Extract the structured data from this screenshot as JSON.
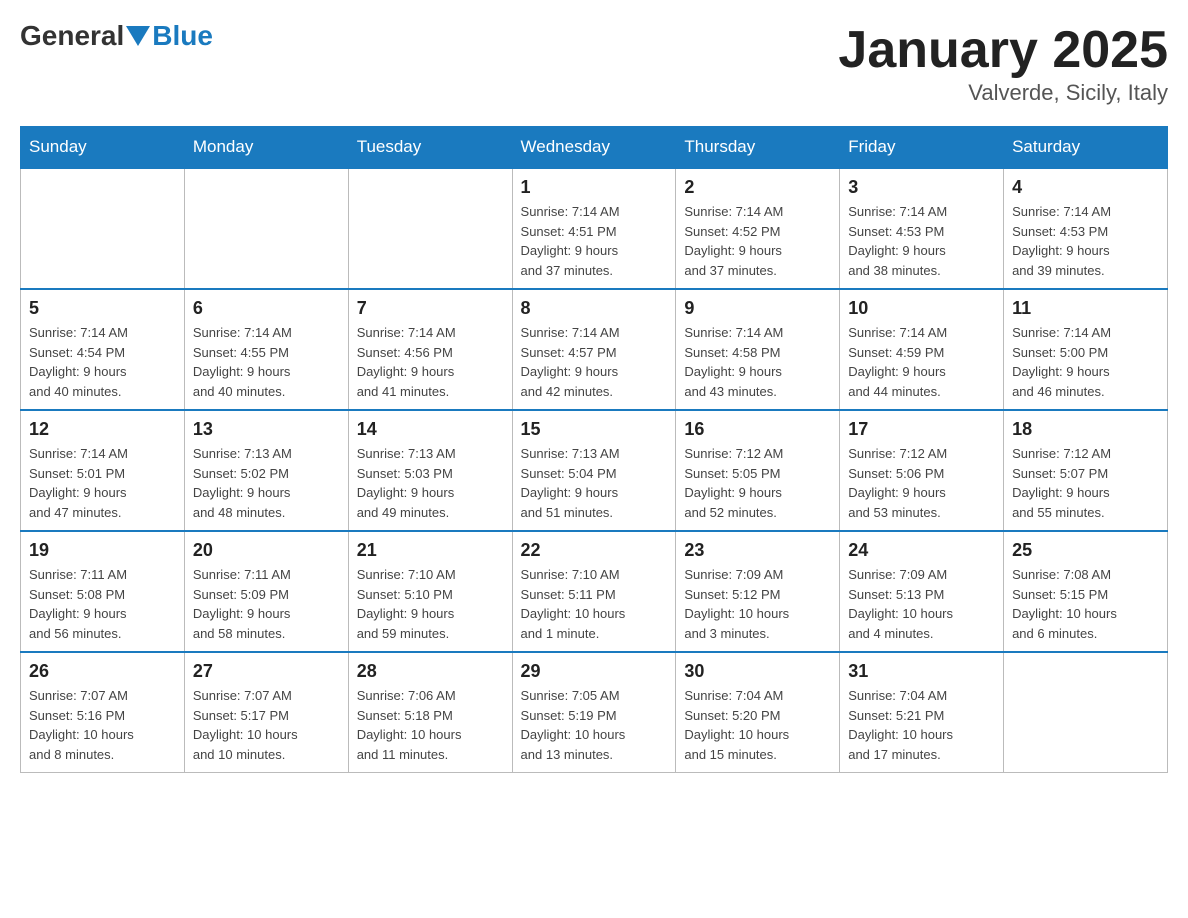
{
  "header": {
    "title": "January 2025",
    "location": "Valverde, Sicily, Italy",
    "logo_general": "General",
    "logo_blue": "Blue"
  },
  "days_of_week": [
    "Sunday",
    "Monday",
    "Tuesday",
    "Wednesday",
    "Thursday",
    "Friday",
    "Saturday"
  ],
  "weeks": [
    [
      {
        "day": "",
        "info": ""
      },
      {
        "day": "",
        "info": ""
      },
      {
        "day": "",
        "info": ""
      },
      {
        "day": "1",
        "info": "Sunrise: 7:14 AM\nSunset: 4:51 PM\nDaylight: 9 hours\nand 37 minutes."
      },
      {
        "day": "2",
        "info": "Sunrise: 7:14 AM\nSunset: 4:52 PM\nDaylight: 9 hours\nand 37 minutes."
      },
      {
        "day": "3",
        "info": "Sunrise: 7:14 AM\nSunset: 4:53 PM\nDaylight: 9 hours\nand 38 minutes."
      },
      {
        "day": "4",
        "info": "Sunrise: 7:14 AM\nSunset: 4:53 PM\nDaylight: 9 hours\nand 39 minutes."
      }
    ],
    [
      {
        "day": "5",
        "info": "Sunrise: 7:14 AM\nSunset: 4:54 PM\nDaylight: 9 hours\nand 40 minutes."
      },
      {
        "day": "6",
        "info": "Sunrise: 7:14 AM\nSunset: 4:55 PM\nDaylight: 9 hours\nand 40 minutes."
      },
      {
        "day": "7",
        "info": "Sunrise: 7:14 AM\nSunset: 4:56 PM\nDaylight: 9 hours\nand 41 minutes."
      },
      {
        "day": "8",
        "info": "Sunrise: 7:14 AM\nSunset: 4:57 PM\nDaylight: 9 hours\nand 42 minutes."
      },
      {
        "day": "9",
        "info": "Sunrise: 7:14 AM\nSunset: 4:58 PM\nDaylight: 9 hours\nand 43 minutes."
      },
      {
        "day": "10",
        "info": "Sunrise: 7:14 AM\nSunset: 4:59 PM\nDaylight: 9 hours\nand 44 minutes."
      },
      {
        "day": "11",
        "info": "Sunrise: 7:14 AM\nSunset: 5:00 PM\nDaylight: 9 hours\nand 46 minutes."
      }
    ],
    [
      {
        "day": "12",
        "info": "Sunrise: 7:14 AM\nSunset: 5:01 PM\nDaylight: 9 hours\nand 47 minutes."
      },
      {
        "day": "13",
        "info": "Sunrise: 7:13 AM\nSunset: 5:02 PM\nDaylight: 9 hours\nand 48 minutes."
      },
      {
        "day": "14",
        "info": "Sunrise: 7:13 AM\nSunset: 5:03 PM\nDaylight: 9 hours\nand 49 minutes."
      },
      {
        "day": "15",
        "info": "Sunrise: 7:13 AM\nSunset: 5:04 PM\nDaylight: 9 hours\nand 51 minutes."
      },
      {
        "day": "16",
        "info": "Sunrise: 7:12 AM\nSunset: 5:05 PM\nDaylight: 9 hours\nand 52 minutes."
      },
      {
        "day": "17",
        "info": "Sunrise: 7:12 AM\nSunset: 5:06 PM\nDaylight: 9 hours\nand 53 minutes."
      },
      {
        "day": "18",
        "info": "Sunrise: 7:12 AM\nSunset: 5:07 PM\nDaylight: 9 hours\nand 55 minutes."
      }
    ],
    [
      {
        "day": "19",
        "info": "Sunrise: 7:11 AM\nSunset: 5:08 PM\nDaylight: 9 hours\nand 56 minutes."
      },
      {
        "day": "20",
        "info": "Sunrise: 7:11 AM\nSunset: 5:09 PM\nDaylight: 9 hours\nand 58 minutes."
      },
      {
        "day": "21",
        "info": "Sunrise: 7:10 AM\nSunset: 5:10 PM\nDaylight: 9 hours\nand 59 minutes."
      },
      {
        "day": "22",
        "info": "Sunrise: 7:10 AM\nSunset: 5:11 PM\nDaylight: 10 hours\nand 1 minute."
      },
      {
        "day": "23",
        "info": "Sunrise: 7:09 AM\nSunset: 5:12 PM\nDaylight: 10 hours\nand 3 minutes."
      },
      {
        "day": "24",
        "info": "Sunrise: 7:09 AM\nSunset: 5:13 PM\nDaylight: 10 hours\nand 4 minutes."
      },
      {
        "day": "25",
        "info": "Sunrise: 7:08 AM\nSunset: 5:15 PM\nDaylight: 10 hours\nand 6 minutes."
      }
    ],
    [
      {
        "day": "26",
        "info": "Sunrise: 7:07 AM\nSunset: 5:16 PM\nDaylight: 10 hours\nand 8 minutes."
      },
      {
        "day": "27",
        "info": "Sunrise: 7:07 AM\nSunset: 5:17 PM\nDaylight: 10 hours\nand 10 minutes."
      },
      {
        "day": "28",
        "info": "Sunrise: 7:06 AM\nSunset: 5:18 PM\nDaylight: 10 hours\nand 11 minutes."
      },
      {
        "day": "29",
        "info": "Sunrise: 7:05 AM\nSunset: 5:19 PM\nDaylight: 10 hours\nand 13 minutes."
      },
      {
        "day": "30",
        "info": "Sunrise: 7:04 AM\nSunset: 5:20 PM\nDaylight: 10 hours\nand 15 minutes."
      },
      {
        "day": "31",
        "info": "Sunrise: 7:04 AM\nSunset: 5:21 PM\nDaylight: 10 hours\nand 17 minutes."
      },
      {
        "day": "",
        "info": ""
      }
    ]
  ]
}
